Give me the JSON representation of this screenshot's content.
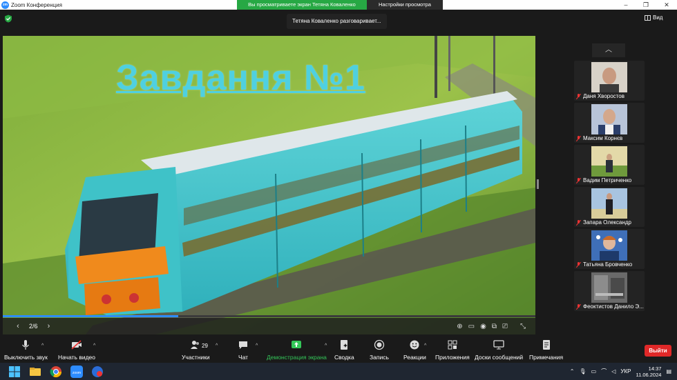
{
  "window": {
    "app_title": "Zoom Конференция",
    "share_banner": "Вы просматриваете экран Тетяна  Коваленко",
    "view_options": "Настройки просмотра"
  },
  "top": {
    "speaker": "Тетяна  Коваленко разговаривает...",
    "view_label": "Вид"
  },
  "slide": {
    "title": "Завдання №1",
    "page": "2/6",
    "progress": 0.33
  },
  "gallery": {
    "participants": [
      {
        "name": "Даня Хворостов",
        "muted": true
      },
      {
        "name": "Максим Корнєв",
        "muted": true
      },
      {
        "name": "Вадим Петриченко",
        "muted": true
      },
      {
        "name": "Запара Олександр",
        "muted": true
      },
      {
        "name": "Татьяна Бровченко",
        "muted": true
      },
      {
        "name": "Феоктистов Данило Э...",
        "muted": true
      }
    ]
  },
  "toolbar": {
    "mute": "Выключить звук",
    "video": "Начать видео",
    "participants": "Участники",
    "participants_count": "29",
    "chat": "Чат",
    "share": "Демонстрация экрана",
    "summary": "Сводка",
    "record": "Запись",
    "reactions": "Реакции",
    "apps": "Приложения",
    "whiteboards": "Доски сообщений",
    "notes": "Примечания",
    "end": "Выйти"
  },
  "taskbar": {
    "lang": "УКР",
    "time": "14:37",
    "date": "11.06.2024"
  },
  "colors": {
    "accent": "#2d8cff",
    "share_green": "#27a844",
    "end_red": "#e02828",
    "title_cyan": "#4fd0e0"
  }
}
